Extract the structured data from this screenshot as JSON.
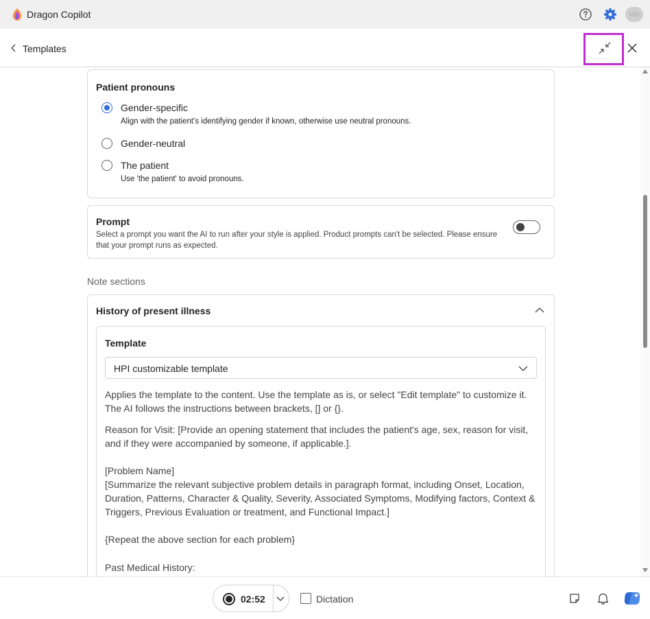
{
  "app": {
    "title": "Dragon Copilot",
    "avatar_initials": "MM"
  },
  "nav": {
    "back_label": "Templates"
  },
  "pronouns": {
    "title": "Patient pronouns",
    "options": [
      {
        "label": "Gender-specific",
        "description": "Align with the patient's identifying gender if known, otherwise use neutral pronouns.",
        "selected": true
      },
      {
        "label": "Gender-neutral",
        "description": "",
        "selected": false
      },
      {
        "label": "The patient",
        "description": "Use 'the patient' to avoid pronouns.",
        "selected": false
      }
    ]
  },
  "prompt": {
    "title": "Prompt",
    "description": "Select a prompt you want the AI to run after your style is applied. Product prompts can't be selected. Please ensure that your prompt runs as expected.",
    "enabled": false
  },
  "note_sections": {
    "heading": "Note sections",
    "section_title": "History of present illness",
    "template_label": "Template",
    "template_value": "HPI customizable template",
    "intro": "Applies the template to the content. Use the template as is, or select \"Edit template\" to customize it. The AI follows the instructions between brackets, [] or {}.",
    "body": [
      "Reason for Visit: [Provide an opening statement that includes the patient's age, sex, reason for visit, and if they were accompanied by someone, if applicable.].",
      "[Problem Name]",
      "[Summarize the relevant subjective problem details in paragraph format, including Onset, Location, Duration, Patterns, Character & Quality, Severity, Associated Symptoms, Modifying factors, Context & Triggers, Previous Evaluation or treatment, and Functional Impact.]",
      "{Repeat the above section for each problem}",
      "Past Medical History:"
    ]
  },
  "bottom": {
    "timer": "02:52",
    "dictation_label": "Dictation",
    "dictation_checked": false
  },
  "colors": {
    "accent": "#2f6bd6",
    "highlight": "#c02ccf"
  }
}
